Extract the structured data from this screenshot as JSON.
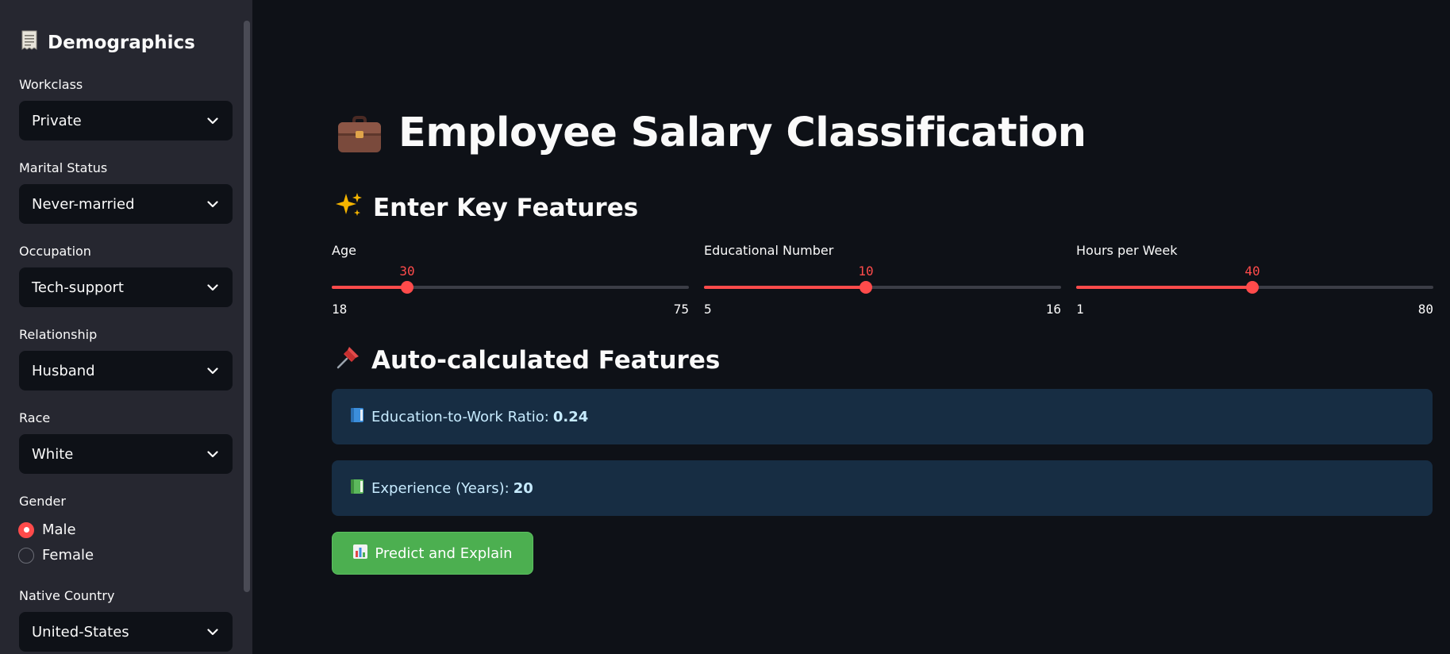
{
  "sidebar": {
    "title": "Demographics",
    "title_icon": "receipt-icon",
    "fields": [
      {
        "label": "Workclass",
        "value": "Private"
      },
      {
        "label": "Marital Status",
        "value": "Never-married"
      },
      {
        "label": "Occupation",
        "value": "Tech-support"
      },
      {
        "label": "Relationship",
        "value": "Husband"
      },
      {
        "label": "Race",
        "value": "White"
      }
    ],
    "gender": {
      "label": "Gender",
      "options": [
        "Male",
        "Female"
      ],
      "selected": "Male"
    },
    "country": {
      "label": "Native Country",
      "value": "United-States"
    }
  },
  "main": {
    "title": "Employee Salary Classification",
    "title_icon": "briefcase-icon",
    "key_features_heading": "Enter Key Features",
    "key_features_icon": "sparkles-icon",
    "sliders": [
      {
        "label": "Age",
        "value": "30",
        "min": "18",
        "max": "75"
      },
      {
        "label": "Educational Number",
        "value": "10",
        "min": "5",
        "max": "16"
      },
      {
        "label": "Hours per Week",
        "value": "40",
        "min": "1",
        "max": "80"
      }
    ],
    "auto_heading": "Auto-calculated Features",
    "auto_icon": "pushpin-icon",
    "info": [
      {
        "label": "Education-to-Work Ratio:",
        "value": "0.24",
        "icon": "blue-book-icon"
      },
      {
        "label": "Experience (Years):",
        "value": "20",
        "icon": "green-book-icon"
      }
    ],
    "predict_button": "Predict and Explain",
    "predict_icon": "bar-chart-icon"
  },
  "colors": {
    "background": "#0e1117",
    "sidebar": "#262730",
    "accent": "#ff4b4b",
    "info_bg": "#172d43",
    "button_green": "#4caf50"
  }
}
